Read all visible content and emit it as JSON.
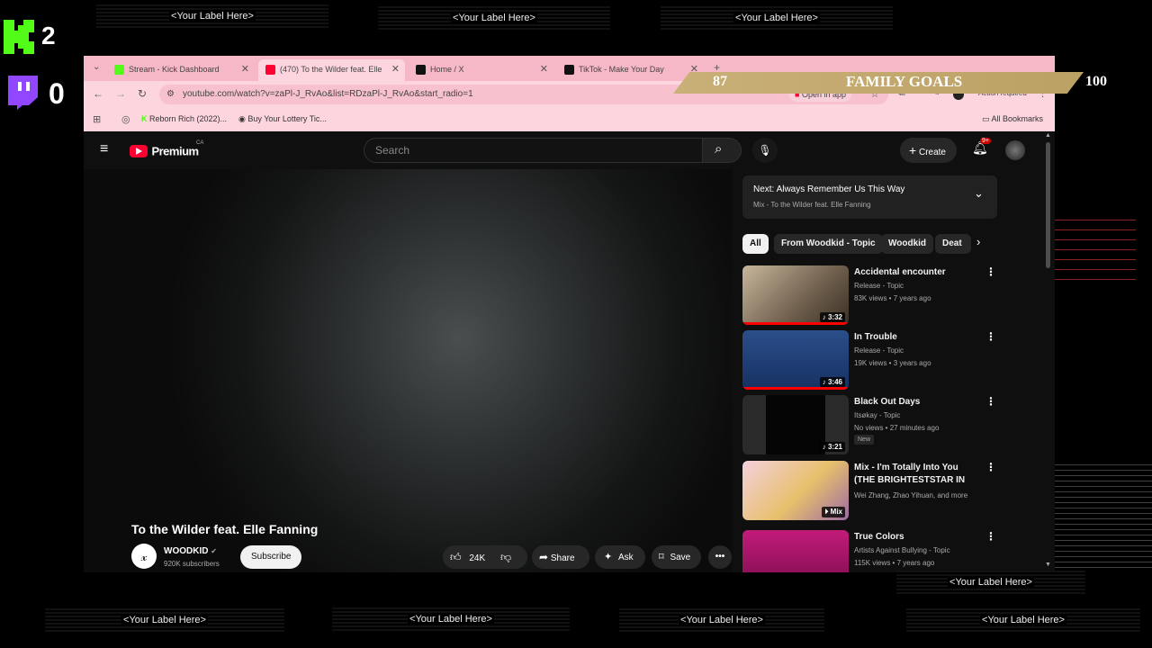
{
  "overlay": {
    "labels_top": [
      "<Your Label Here>",
      "<Your Label Here>",
      "<Your Label Here>"
    ],
    "labels_bottom": [
      "<Your Label Here>",
      "<Your Label Here>",
      "<Your Label Here>",
      "<Your Label Here>"
    ],
    "label_side": "<Your Label Here>",
    "kick_count": "2",
    "twitch_count": "0",
    "goal": {
      "current": "87",
      "title": "FAMILY GOALS",
      "target": "100",
      "color": "#c9b078"
    }
  },
  "browser": {
    "tabs": [
      {
        "title": "Stream - Kick Dashboard",
        "icon": "kick-icon",
        "color": "#53fc18"
      },
      {
        "title": "(470) To the Wilder feat. Elle",
        "icon": "youtube-icon",
        "color": "#ff0033",
        "active": true
      },
      {
        "title": "Home / X",
        "icon": "x-icon",
        "color": "#000000"
      },
      {
        "title": "TikTok - Make Your Day",
        "icon": "tiktok-icon",
        "color": "#000000"
      }
    ],
    "new_tab": "+",
    "url": "youtube.com/watch?v=zaPl-J_RvAo&list=RDzaPl-J_RvAo&start_radio=1",
    "open_in_app": "Open in app",
    "action_required": "Action required",
    "bookmarks": [
      "Reborn Rich (2022)...",
      "Buy Your Lottery Tic..."
    ],
    "all_bookmarks": "All Bookmarks"
  },
  "youtube": {
    "logo": "Premium",
    "region": "CA",
    "search_placeholder": "Search",
    "create": "Create",
    "notif_badge": "9+",
    "next_label": "Next: Always Remember Us This Way",
    "next_sub": "Mix - To the Wilder feat. Elle Fanning",
    "chips": [
      "All",
      "From Woodkid - Topic",
      "Woodkid",
      "Deat"
    ],
    "video_title": "To the Wilder feat. Elle Fanning",
    "channel": "WOODKID",
    "subscribers": "920K subscribers",
    "subscribe": "Subscribe",
    "likes": "24K",
    "share": "Share",
    "ask": "Ask",
    "save": "Save",
    "sidebar": [
      {
        "title": "Accidental encounter",
        "channel": "Release - Topic",
        "meta": "83K views • 7 years ago",
        "duration": "3:32",
        "thumb": "#8a7f6e"
      },
      {
        "title": "In Trouble",
        "channel": "Release - Topic",
        "meta": "19K views • 3 years ago",
        "duration": "3:46",
        "thumb": "#1c3b6e"
      },
      {
        "title": "Black Out Days",
        "channel": "Itsøkay - Topic",
        "meta": "No views • 27 minutes ago",
        "badge": "New",
        "duration": "3:21",
        "thumb": "#111111"
      },
      {
        "title": "Mix - I'm Totally Into You (THE BRIGHTESTSTAR IN THE NIG...",
        "channel": "Wei Zhang, Zhao Yihuan, and more",
        "meta": "",
        "duration": "Mix",
        "thumb": "#e0b4c8"
      },
      {
        "title": "True Colors",
        "channel": "Artists Against Bullying - Topic",
        "meta": "115K views • 7 years ago",
        "duration": "",
        "thumb": "#b0166e"
      }
    ]
  }
}
